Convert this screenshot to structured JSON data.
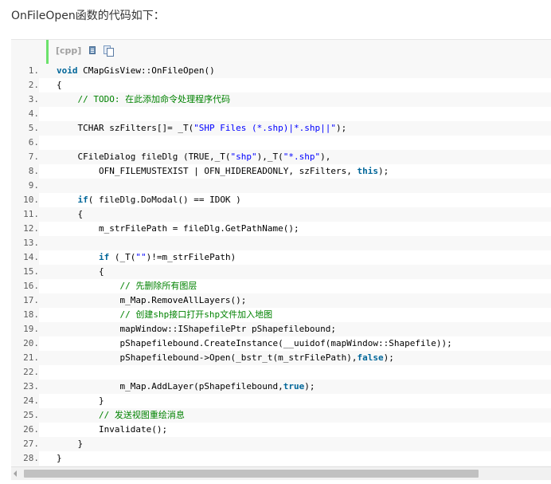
{
  "intro": "OnFileOpen函数的代码如下：",
  "toolbar": {
    "lang_label": "[cpp]",
    "view_icon": "view-plain-icon",
    "copy_icon": "copy-icon"
  },
  "colors": {
    "keyword": "#006699",
    "string": "#0000ff",
    "comment": "#008200",
    "accent_bar": "#6ce26c"
  },
  "code": {
    "line_numbers": [
      "1.",
      "2.",
      "3.",
      "4.",
      "5.",
      "6.",
      "7.",
      "8.",
      "9.",
      "10.",
      "11.",
      "12.",
      "13.",
      "14.",
      "15.",
      "16.",
      "17.",
      "18.",
      "19.",
      "20.",
      "21.",
      "22.",
      "23.",
      "24.",
      "25.",
      "26.",
      "27.",
      "28."
    ],
    "lines": [
      [
        {
          "t": "kw",
          "v": "void"
        },
        {
          "t": "p",
          "v": " CMapGisView::OnFileOpen()"
        }
      ],
      [
        {
          "t": "p",
          "v": "{"
        }
      ],
      [
        {
          "t": "p",
          "v": "    "
        },
        {
          "t": "cm",
          "v": "// TODO: 在此添加命令处理程序代码"
        }
      ],
      [],
      [
        {
          "t": "p",
          "v": "    TCHAR szFilters[]= _T("
        },
        {
          "t": "str",
          "v": "\"SHP Files (*.shp)|*.shp||\""
        },
        {
          "t": "p",
          "v": ");"
        }
      ],
      [],
      [
        {
          "t": "p",
          "v": "    CFileDialog fileDlg (TRUE,_T("
        },
        {
          "t": "str",
          "v": "\"shp\""
        },
        {
          "t": "p",
          "v": "),_T("
        },
        {
          "t": "str",
          "v": "\"*.shp\""
        },
        {
          "t": "p",
          "v": "),"
        }
      ],
      [
        {
          "t": "p",
          "v": "        OFN_FILEMUSTEXIST | OFN_HIDEREADONLY, szFilters, "
        },
        {
          "t": "kw",
          "v": "this"
        },
        {
          "t": "p",
          "v": ");"
        }
      ],
      [],
      [
        {
          "t": "p",
          "v": "    "
        },
        {
          "t": "kw",
          "v": "if"
        },
        {
          "t": "p",
          "v": "( fileDlg.DoModal() == IDOK )"
        }
      ],
      [
        {
          "t": "p",
          "v": "    {"
        }
      ],
      [
        {
          "t": "p",
          "v": "        m_strFilePath = fileDlg.GetPathName();"
        }
      ],
      [],
      [
        {
          "t": "p",
          "v": "        "
        },
        {
          "t": "kw",
          "v": "if"
        },
        {
          "t": "p",
          "v": " (_T("
        },
        {
          "t": "str",
          "v": "\"\""
        },
        {
          "t": "p",
          "v": ")!=m_strFilePath)"
        }
      ],
      [
        {
          "t": "p",
          "v": "        {"
        }
      ],
      [
        {
          "t": "p",
          "v": "            "
        },
        {
          "t": "cm",
          "v": "// 先删除所有图层"
        }
      ],
      [
        {
          "t": "p",
          "v": "            m_Map.RemoveAllLayers();"
        }
      ],
      [
        {
          "t": "p",
          "v": "            "
        },
        {
          "t": "cm",
          "v": "// 创建shp接口打开shp文件加入地图"
        }
      ],
      [
        {
          "t": "p",
          "v": "            mapWindow::IShapefilePtr pShapefilebound;"
        }
      ],
      [
        {
          "t": "p",
          "v": "            pShapefilebound.CreateInstance(__uuidof(mapWindow::Shapefile));"
        }
      ],
      [
        {
          "t": "p",
          "v": "            pShapefilebound->Open(_bstr_t(m_strFilePath),"
        },
        {
          "t": "kw",
          "v": "false"
        },
        {
          "t": "p",
          "v": ");"
        }
      ],
      [],
      [
        {
          "t": "p",
          "v": "            m_Map.AddLayer(pShapefilebound,"
        },
        {
          "t": "kw",
          "v": "true"
        },
        {
          "t": "p",
          "v": ");"
        }
      ],
      [
        {
          "t": "p",
          "v": "        }"
        }
      ],
      [
        {
          "t": "p",
          "v": "        "
        },
        {
          "t": "cm",
          "v": "// 发送视图重绘消息"
        }
      ],
      [
        {
          "t": "p",
          "v": "        Invalidate();"
        }
      ],
      [
        {
          "t": "p",
          "v": "    }"
        }
      ],
      [
        {
          "t": "p",
          "v": "}"
        }
      ]
    ]
  },
  "scrollbar": {
    "left_arrow_icon": "arrow-left-icon"
  }
}
